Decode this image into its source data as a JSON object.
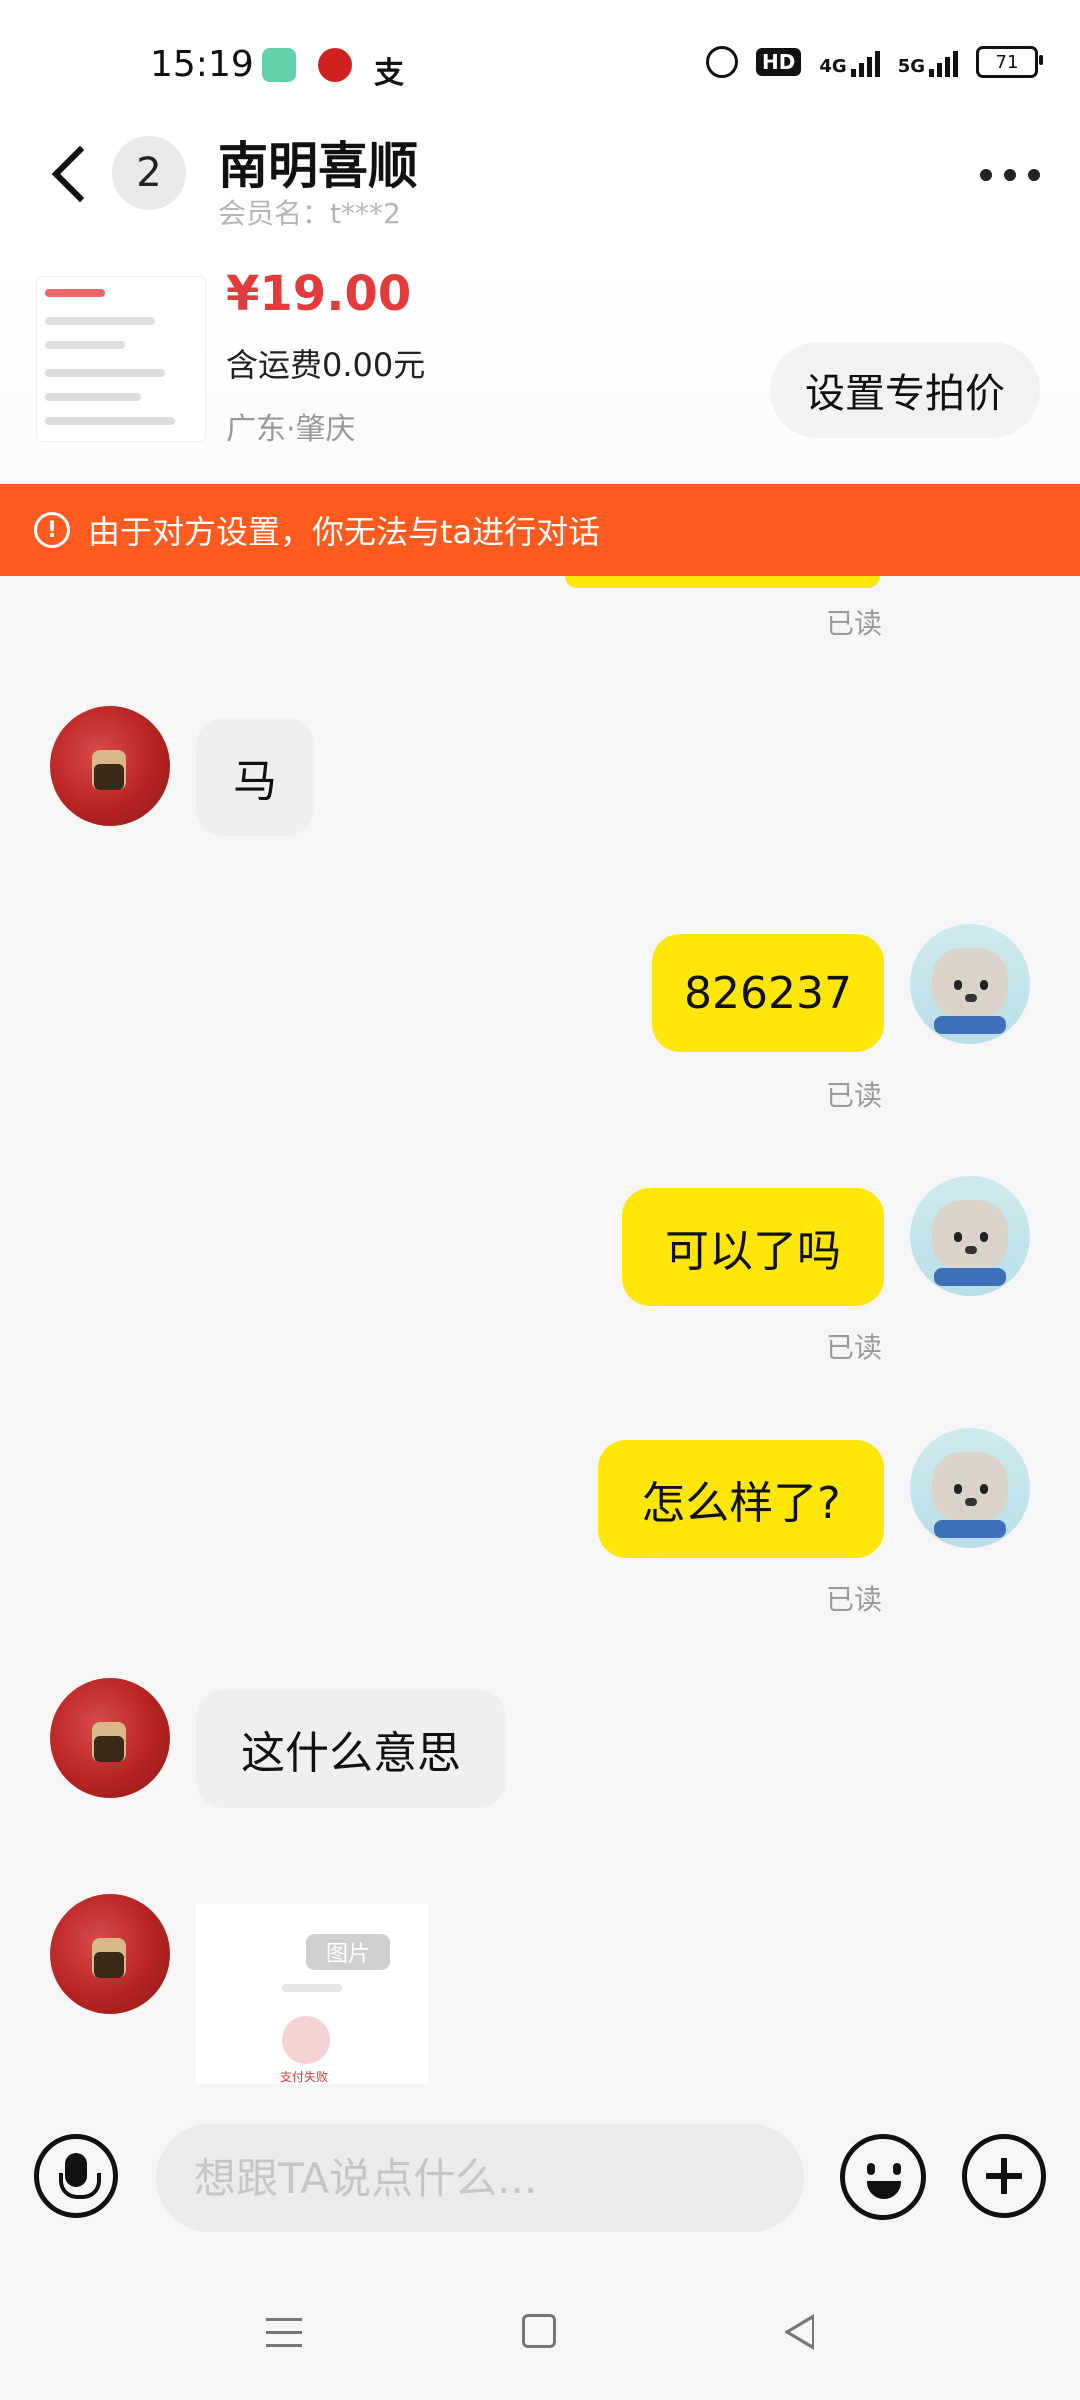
{
  "status_bar": {
    "time": "15:19",
    "app_icons": [
      "wechat-like-app-icon",
      "bank-app-icon",
      "alipay-icon"
    ],
    "right_icons": [
      "alarm-icon",
      "hd-icon",
      "4g-signal-icon",
      "5g-signal-icon",
      "battery-icon"
    ],
    "hd": "HD",
    "net1": "4G",
    "net2": "5G",
    "battery": "71"
  },
  "header": {
    "unread_count": "2",
    "shop_name": "南明喜顺",
    "member": "会员名：t***2"
  },
  "product": {
    "price": "¥19.00",
    "shipping": "含运费0.00元",
    "region": "广东·肇庆",
    "special_price_button": "设置专拍价"
  },
  "banner": {
    "text": "由于对方设置，你无法与ta进行对话"
  },
  "messages": [
    {
      "from": "self",
      "status": "已读"
    },
    {
      "from": "other",
      "text": "马"
    },
    {
      "from": "self",
      "text": "826237",
      "status": "已读"
    },
    {
      "from": "self",
      "text": "可以了吗",
      "status": "已读"
    },
    {
      "from": "self",
      "text": "怎么样了?",
      "status": "已读"
    },
    {
      "from": "other",
      "text": "这什么意思"
    },
    {
      "from": "other",
      "type": "image",
      "badge": "图片",
      "image_caption": "支付失败"
    }
  ],
  "input": {
    "placeholder": "想跟TA说点什么..."
  },
  "colors": {
    "accent_yellow": "#ffe60a",
    "banner_orange": "#ff5b21",
    "price_red": "#e33b3b"
  }
}
